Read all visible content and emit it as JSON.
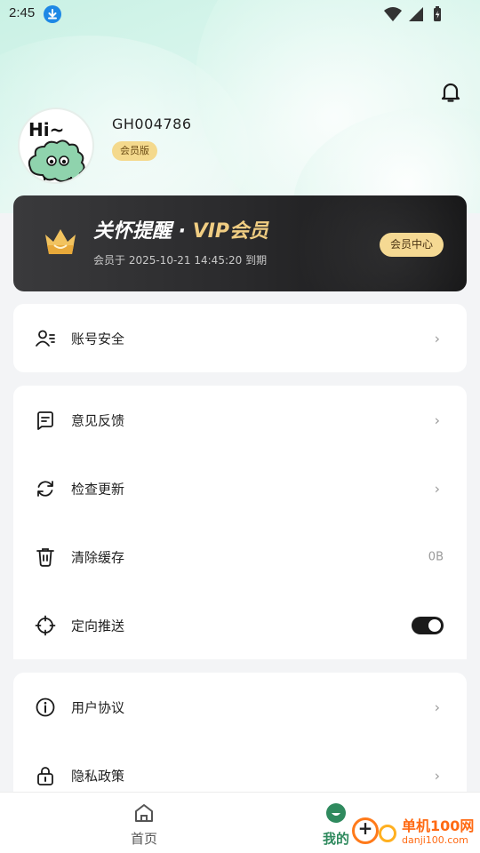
{
  "status_bar": {
    "time": "2:45",
    "icons": [
      "download-icon",
      "wifi-icon",
      "signal-icon",
      "battery-icon"
    ]
  },
  "profile": {
    "avatar_text": "Hi~",
    "user_id": "GH004786",
    "badge": "会员版"
  },
  "vip_card": {
    "title_prefix": "关怀提醒 · ",
    "title_vip": "VIP会员",
    "expire_text": "会员于 2025-10-21 14:45:20 到期",
    "center_button": "会员中心"
  },
  "menu_groups": [
    {
      "items": [
        {
          "label": "账号安全",
          "icon": "user-list-icon",
          "trailing": "chevron"
        }
      ]
    },
    {
      "items": [
        {
          "label": "意见反馈",
          "icon": "feedback-icon",
          "trailing": "chevron"
        },
        {
          "label": "检查更新",
          "icon": "refresh-icon",
          "trailing": "chevron"
        },
        {
          "label": "清除缓存",
          "icon": "trash-icon",
          "trailing": "value",
          "value": "0B"
        },
        {
          "label": "定向推送",
          "icon": "target-icon",
          "trailing": "toggle",
          "toggle_on": true
        }
      ]
    },
    {
      "items": [
        {
          "label": "用户协议",
          "icon": "info-icon",
          "trailing": "chevron"
        },
        {
          "label": "隐私政策",
          "icon": "lock-icon",
          "trailing": "chevron"
        }
      ]
    }
  ],
  "tabbar": {
    "tabs": [
      {
        "label": "首页",
        "icon": "home-icon",
        "active": false
      },
      {
        "label": "我的",
        "icon": "profile-face-icon",
        "active": true
      }
    ]
  },
  "watermark": {
    "brand": "单机100网",
    "domain": "danji100.com"
  },
  "colors": {
    "accent_green": "#2f8a5e",
    "vip_gold": "#f0cd82",
    "badge_gold": "#f4d98d",
    "vip_dark": "#2a2a2c"
  }
}
